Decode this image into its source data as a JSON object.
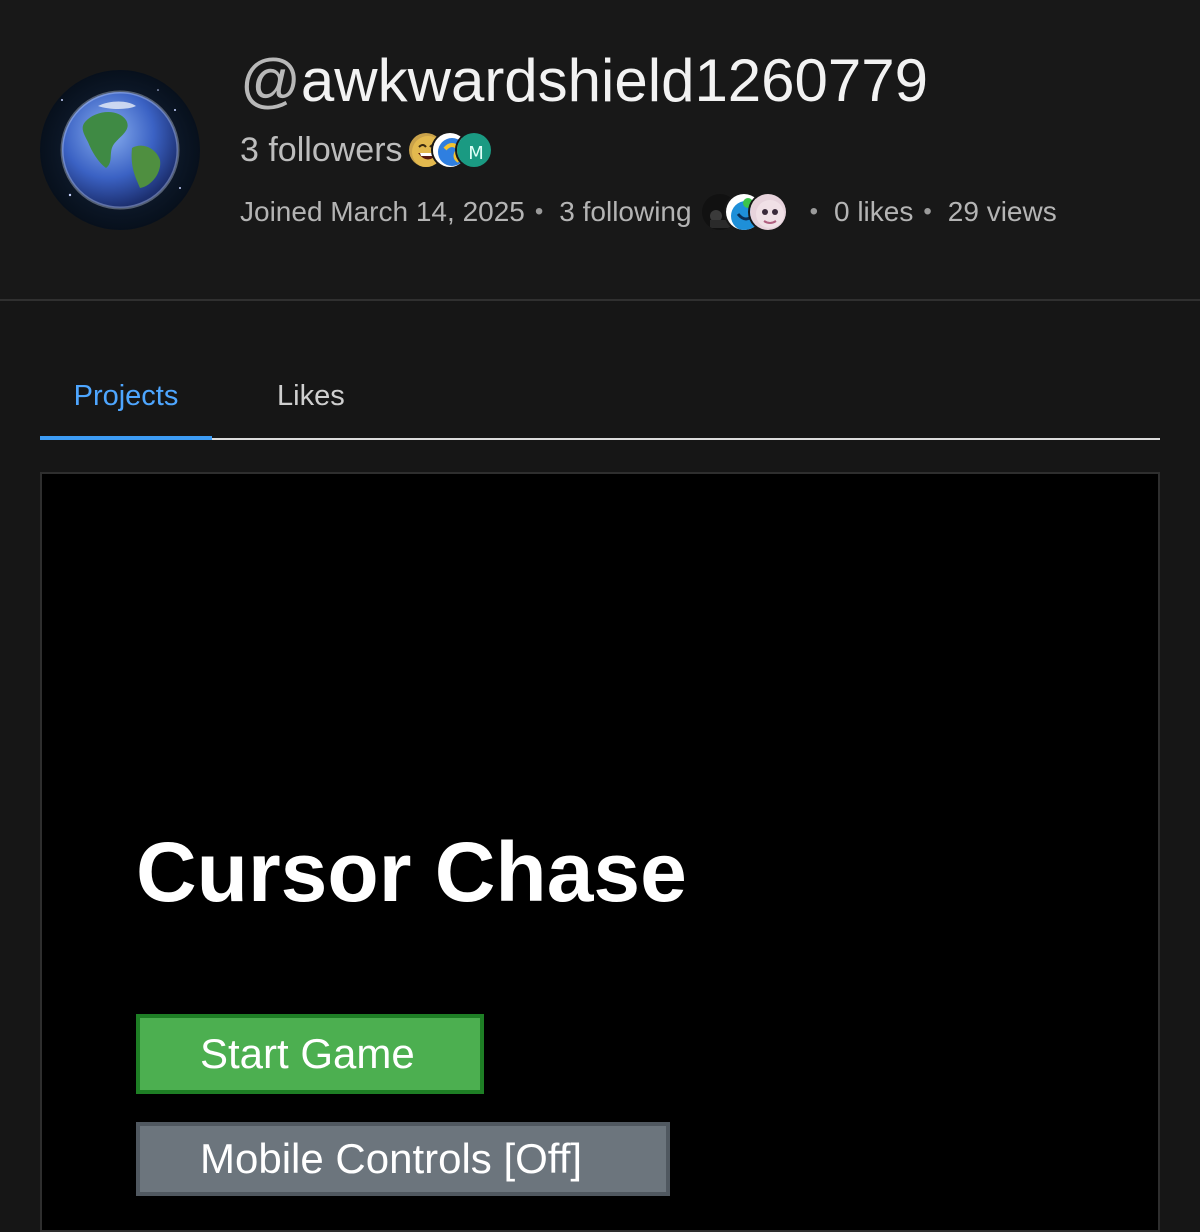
{
  "profile": {
    "at_sign": "@",
    "handle": "awkwardshield1260779",
    "followers_label": "3 followers",
    "joined_label": "Joined March 14, 2025",
    "following_label": "3 following",
    "likes_label": "0 likes",
    "views_label": "29 views",
    "separator": "•"
  },
  "tabs": [
    {
      "label": "Projects",
      "active": true
    },
    {
      "label": "Likes",
      "active": false
    }
  ],
  "game": {
    "title": "Cursor Chase",
    "start_label": "Start Game",
    "mobile_label": "Mobile Controls [Off]"
  },
  "colors": {
    "accent": "#3d9cf5",
    "start_button": "#4caf50",
    "mobile_button": "#6c757d"
  },
  "icons": {
    "avatar": "earth-avatar-icon",
    "followers": [
      "laughing-face-avatar-icon",
      "blue-swirl-avatar-icon",
      "teal-letter-m-avatar-icon"
    ],
    "following": [
      "dark-figure-avatar-icon",
      "blue-green-avatar-icon",
      "pink-face-avatar-icon"
    ]
  }
}
